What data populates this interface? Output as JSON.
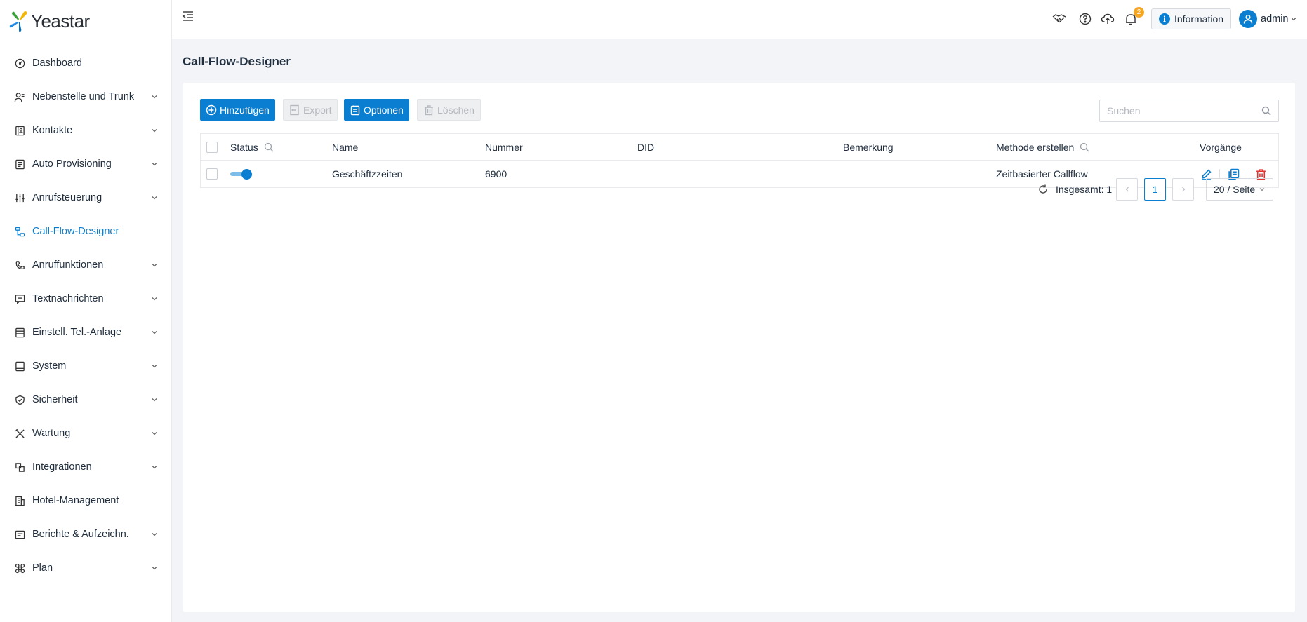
{
  "app": {
    "logo_text": "Yeastar"
  },
  "sidebar": {
    "items": [
      {
        "label": "Dashboard",
        "icon": "dashboard-icon",
        "has_children": false
      },
      {
        "label": "Nebenstelle und Trunk",
        "icon": "users-icon",
        "has_children": true
      },
      {
        "label": "Kontakte",
        "icon": "contacts-icon",
        "has_children": true
      },
      {
        "label": "Auto Provisioning",
        "icon": "provisioning-icon",
        "has_children": true
      },
      {
        "label": "Anrufsteuerung",
        "icon": "sliders-icon",
        "has_children": true
      },
      {
        "label": "Call-Flow-Designer",
        "icon": "flow-icon",
        "has_children": false,
        "active": true
      },
      {
        "label": "Anruffunktionen",
        "icon": "phone-icon",
        "has_children": true
      },
      {
        "label": "Textnachrichten",
        "icon": "chat-icon",
        "has_children": true
      },
      {
        "label": "Einstell. Tel.-Anlage",
        "icon": "pbx-icon",
        "has_children": true
      },
      {
        "label": "System",
        "icon": "monitor-icon",
        "has_children": true
      },
      {
        "label": "Sicherheit",
        "icon": "shield-icon",
        "has_children": true
      },
      {
        "label": "Wartung",
        "icon": "tools-icon",
        "has_children": true
      },
      {
        "label": "Integrationen",
        "icon": "integration-icon",
        "has_children": true
      },
      {
        "label": "Hotel-Management",
        "icon": "building-icon",
        "has_children": false
      },
      {
        "label": "Berichte & Aufzeichn.",
        "icon": "report-icon",
        "has_children": true
      },
      {
        "label": "Plan",
        "icon": "command-icon",
        "has_children": true
      }
    ]
  },
  "header": {
    "notification_count": "2",
    "information_label": "Information",
    "user_name": "admin"
  },
  "page": {
    "title": "Call-Flow-Designer"
  },
  "toolbar": {
    "add_label": "Hinzufügen",
    "export_label": "Export",
    "options_label": "Optionen",
    "delete_label": "Löschen",
    "search_placeholder": "Suchen"
  },
  "table": {
    "columns": {
      "status": "Status",
      "name": "Name",
      "number": "Nummer",
      "did": "DID",
      "remark": "Bemerkung",
      "method": "Methode erstellen",
      "actions": "Vorgänge"
    },
    "rows": [
      {
        "enabled": true,
        "name": "Geschäftzzeiten",
        "number": "6900",
        "did": "",
        "remark": "",
        "method": "Zeitbasierter Callflow"
      }
    ]
  },
  "pagination": {
    "total_label": "Insgesamt: 1",
    "current_page": "1",
    "page_size_label": "20 / Seite"
  },
  "colors": {
    "accent": "#0a7ed1",
    "danger": "#e5322d",
    "badge": "#f5a623"
  }
}
